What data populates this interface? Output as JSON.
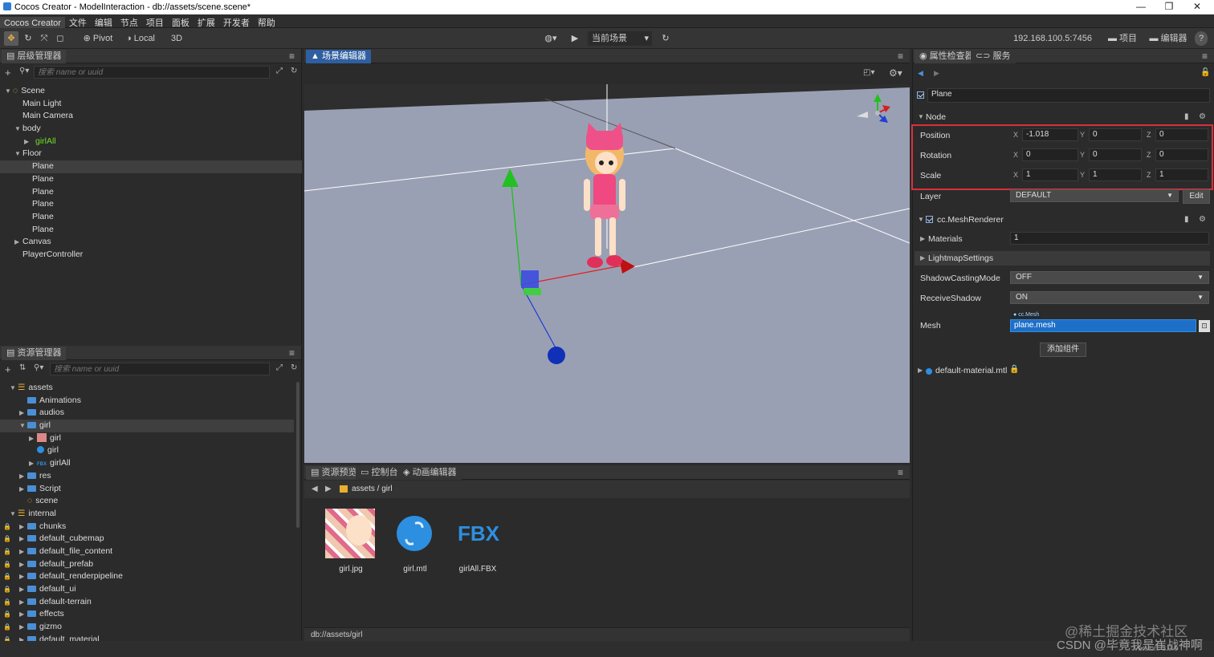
{
  "window": {
    "title": "Cocos Creator - ModelInteraction - db://assets/scene.scene*",
    "controls": [
      "—",
      "❐",
      "✕"
    ]
  },
  "menu": [
    "Cocos Creator",
    "文件",
    "编辑",
    "节点",
    "项目",
    "面板",
    "扩展",
    "开发者",
    "帮助"
  ],
  "toolbar": {
    "pivot": "Pivot",
    "local": "Local",
    "mode3d": "3D",
    "scene_select": "当前场景",
    "ip": "192.168.100.5:7456",
    "project": "项目",
    "editor": "编辑器",
    "help": "?"
  },
  "hierarchy": {
    "tab": "层级管理器",
    "search_placeholder": "搜索 name or uuid",
    "items": [
      {
        "label": "Scene",
        "depth": 0,
        "arrow": "▼",
        "kind": "scene"
      },
      {
        "label": "Main Light",
        "depth": 1,
        "arrow": ""
      },
      {
        "label": "Main Camera",
        "depth": 1,
        "arrow": ""
      },
      {
        "label": "body",
        "depth": 1,
        "arrow": "▼"
      },
      {
        "label": "girlAll",
        "depth": 2,
        "arrow": "▶",
        "kind": "prefab"
      },
      {
        "label": "Floor",
        "depth": 1,
        "arrow": "▼"
      },
      {
        "label": "Plane",
        "depth": 2,
        "arrow": "",
        "selected": true
      },
      {
        "label": "Plane",
        "depth": 2,
        "arrow": ""
      },
      {
        "label": "Plane",
        "depth": 2,
        "arrow": ""
      },
      {
        "label": "Plane",
        "depth": 2,
        "arrow": ""
      },
      {
        "label": "Plane",
        "depth": 2,
        "arrow": ""
      },
      {
        "label": "Plane",
        "depth": 2,
        "arrow": ""
      },
      {
        "label": "Canvas",
        "depth": 1,
        "arrow": "▶"
      },
      {
        "label": "PlayerController",
        "depth": 1,
        "arrow": ""
      }
    ]
  },
  "assets": {
    "tab": "资源管理器",
    "search_placeholder": "搜索 name or uuid",
    "items": [
      {
        "label": "assets",
        "depth": 0,
        "arrow": "▼",
        "kind": "db"
      },
      {
        "label": "Animations",
        "depth": 1,
        "arrow": "",
        "kind": "folder"
      },
      {
        "label": "audios",
        "depth": 1,
        "arrow": "▶",
        "kind": "folder"
      },
      {
        "label": "girl",
        "depth": 1,
        "arrow": "▼",
        "kind": "folder",
        "selected": true
      },
      {
        "label": "girl",
        "depth": 2,
        "arrow": "▶",
        "kind": "image"
      },
      {
        "label": "girl",
        "depth": 2,
        "arrow": "",
        "kind": "material"
      },
      {
        "label": "girlAll",
        "depth": 2,
        "arrow": "▶",
        "kind": "fbx",
        "badge": "FBX"
      },
      {
        "label": "res",
        "depth": 1,
        "arrow": "▶",
        "kind": "folder"
      },
      {
        "label": "Script",
        "depth": 1,
        "arrow": "▶",
        "kind": "folder"
      },
      {
        "label": "scene",
        "depth": 1,
        "arrow": "",
        "kind": "scene"
      },
      {
        "label": "internal",
        "depth": 0,
        "arrow": "▼",
        "kind": "db"
      },
      {
        "label": "chunks",
        "depth": 1,
        "arrow": "▶",
        "kind": "folder",
        "lock": true
      },
      {
        "label": "default_cubemap",
        "depth": 1,
        "arrow": "▶",
        "kind": "folder",
        "lock": true
      },
      {
        "label": "default_file_content",
        "depth": 1,
        "arrow": "▶",
        "kind": "folder",
        "lock": true
      },
      {
        "label": "default_prefab",
        "depth": 1,
        "arrow": "▶",
        "kind": "folder",
        "lock": true
      },
      {
        "label": "default_renderpipeline",
        "depth": 1,
        "arrow": "▶",
        "kind": "folder",
        "lock": true
      },
      {
        "label": "default_ui",
        "depth": 1,
        "arrow": "▶",
        "kind": "folder",
        "lock": true
      },
      {
        "label": "default-terrain",
        "depth": 1,
        "arrow": "▶",
        "kind": "folder",
        "lock": true
      },
      {
        "label": "effects",
        "depth": 1,
        "arrow": "▶",
        "kind": "folder",
        "lock": true
      },
      {
        "label": "gizmo",
        "depth": 1,
        "arrow": "▶",
        "kind": "folder",
        "lock": true
      },
      {
        "label": "default_material",
        "depth": 1,
        "arrow": "▶",
        "kind": "folder",
        "lock": true
      }
    ]
  },
  "scene_editor": {
    "tab": "场景编辑器"
  },
  "bottom": {
    "tabs": [
      "资源预览",
      "控制台",
      "动画编辑器"
    ],
    "path": "assets / girl",
    "files": [
      {
        "name": "girl.jpg",
        "kind": "image"
      },
      {
        "name": "girl.mtl",
        "kind": "material"
      },
      {
        "name": "girlAll.FBX",
        "kind": "fbx",
        "badge": "FBX"
      }
    ],
    "status_path": "db://assets/girl"
  },
  "inspector": {
    "tabs": [
      "属性检查器",
      "服务"
    ],
    "node_name": "Plane",
    "node_section": "Node",
    "position": {
      "label": "Position",
      "x": "-1.018",
      "y": "0",
      "z": "0"
    },
    "rotation": {
      "label": "Rotation",
      "x": "0",
      "y": "0",
      "z": "0"
    },
    "scale": {
      "label": "Scale",
      "x": "1",
      "y": "1",
      "z": "1"
    },
    "axis": {
      "x": "X",
      "y": "Y",
      "z": "Z"
    },
    "layer": {
      "label": "Layer",
      "value": "DEFAULT",
      "edit": "Edit"
    },
    "mesh_renderer": "cc.MeshRenderer",
    "materials": {
      "label": "Materials",
      "value": "1"
    },
    "lightmap": "LightmapSettings",
    "shadow_casting": {
      "label": "ShadowCastingMode",
      "value": "OFF"
    },
    "receive_shadow": {
      "label": "ReceiveShadow",
      "value": "ON"
    },
    "mesh": {
      "label": "Mesh",
      "type": "cc.Mesh",
      "value": "plane.mesh"
    },
    "add_component": "添加组件",
    "material_asset": "default-material.mtl"
  },
  "watermark": {
    "line1": "@稀土掘金技术社区",
    "line2": "CSDN @毕竟我是崔战神啊",
    "version": "Version: 3.0.0"
  },
  "colors": {
    "accent": "#2f5fa0",
    "highlight": "#d9303a",
    "mesh_field": "#1e6fc8",
    "prefab_green": "#6fdc2a"
  }
}
